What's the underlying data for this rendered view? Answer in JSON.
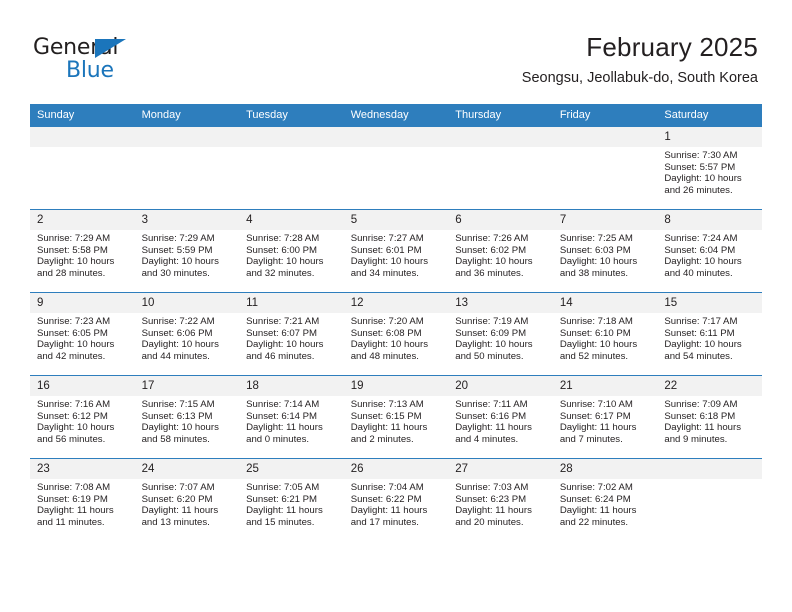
{
  "brand": {
    "name_line1": "General",
    "name_line2": "Blue",
    "icon": "triangle-logo-icon",
    "color_dark": "#221f1f",
    "color_blue": "#1b75bb"
  },
  "header": {
    "title": "February 2025",
    "subtitle": "Seongsu, Jeollabuk-do, South Korea"
  },
  "theme": {
    "header_row_bg": "#2e7ebd",
    "header_row_text": "#ffffff",
    "daynum_band_bg": "#f2f2f2",
    "cell_border": "#2e7ebd",
    "text": "#231f20"
  },
  "weekdays": [
    "Sunday",
    "Monday",
    "Tuesday",
    "Wednesday",
    "Thursday",
    "Friday",
    "Saturday"
  ],
  "labels": {
    "sunrise_prefix": "Sunrise:",
    "sunset_prefix": "Sunset:",
    "daylight_prefix": "Daylight:"
  },
  "weeks": [
    [
      {
        "day": "",
        "empty": true
      },
      {
        "day": "",
        "empty": true
      },
      {
        "day": "",
        "empty": true
      },
      {
        "day": "",
        "empty": true
      },
      {
        "day": "",
        "empty": true
      },
      {
        "day": "",
        "empty": true
      },
      {
        "day": "1",
        "sunrise": "Sunrise: 7:30 AM",
        "sunset": "Sunset: 5:57 PM",
        "daylight": "Daylight: 10 hours and 26 minutes."
      }
    ],
    [
      {
        "day": "2",
        "sunrise": "Sunrise: 7:29 AM",
        "sunset": "Sunset: 5:58 PM",
        "daylight": "Daylight: 10 hours and 28 minutes."
      },
      {
        "day": "3",
        "sunrise": "Sunrise: 7:29 AM",
        "sunset": "Sunset: 5:59 PM",
        "daylight": "Daylight: 10 hours and 30 minutes."
      },
      {
        "day": "4",
        "sunrise": "Sunrise: 7:28 AM",
        "sunset": "Sunset: 6:00 PM",
        "daylight": "Daylight: 10 hours and 32 minutes."
      },
      {
        "day": "5",
        "sunrise": "Sunrise: 7:27 AM",
        "sunset": "Sunset: 6:01 PM",
        "daylight": "Daylight: 10 hours and 34 minutes."
      },
      {
        "day": "6",
        "sunrise": "Sunrise: 7:26 AM",
        "sunset": "Sunset: 6:02 PM",
        "daylight": "Daylight: 10 hours and 36 minutes."
      },
      {
        "day": "7",
        "sunrise": "Sunrise: 7:25 AM",
        "sunset": "Sunset: 6:03 PM",
        "daylight": "Daylight: 10 hours and 38 minutes."
      },
      {
        "day": "8",
        "sunrise": "Sunrise: 7:24 AM",
        "sunset": "Sunset: 6:04 PM",
        "daylight": "Daylight: 10 hours and 40 minutes."
      }
    ],
    [
      {
        "day": "9",
        "sunrise": "Sunrise: 7:23 AM",
        "sunset": "Sunset: 6:05 PM",
        "daylight": "Daylight: 10 hours and 42 minutes."
      },
      {
        "day": "10",
        "sunrise": "Sunrise: 7:22 AM",
        "sunset": "Sunset: 6:06 PM",
        "daylight": "Daylight: 10 hours and 44 minutes."
      },
      {
        "day": "11",
        "sunrise": "Sunrise: 7:21 AM",
        "sunset": "Sunset: 6:07 PM",
        "daylight": "Daylight: 10 hours and 46 minutes."
      },
      {
        "day": "12",
        "sunrise": "Sunrise: 7:20 AM",
        "sunset": "Sunset: 6:08 PM",
        "daylight": "Daylight: 10 hours and 48 minutes."
      },
      {
        "day": "13",
        "sunrise": "Sunrise: 7:19 AM",
        "sunset": "Sunset: 6:09 PM",
        "daylight": "Daylight: 10 hours and 50 minutes."
      },
      {
        "day": "14",
        "sunrise": "Sunrise: 7:18 AM",
        "sunset": "Sunset: 6:10 PM",
        "daylight": "Daylight: 10 hours and 52 minutes."
      },
      {
        "day": "15",
        "sunrise": "Sunrise: 7:17 AM",
        "sunset": "Sunset: 6:11 PM",
        "daylight": "Daylight: 10 hours and 54 minutes."
      }
    ],
    [
      {
        "day": "16",
        "sunrise": "Sunrise: 7:16 AM",
        "sunset": "Sunset: 6:12 PM",
        "daylight": "Daylight: 10 hours and 56 minutes."
      },
      {
        "day": "17",
        "sunrise": "Sunrise: 7:15 AM",
        "sunset": "Sunset: 6:13 PM",
        "daylight": "Daylight: 10 hours and 58 minutes."
      },
      {
        "day": "18",
        "sunrise": "Sunrise: 7:14 AM",
        "sunset": "Sunset: 6:14 PM",
        "daylight": "Daylight: 11 hours and 0 minutes."
      },
      {
        "day": "19",
        "sunrise": "Sunrise: 7:13 AM",
        "sunset": "Sunset: 6:15 PM",
        "daylight": "Daylight: 11 hours and 2 minutes."
      },
      {
        "day": "20",
        "sunrise": "Sunrise: 7:11 AM",
        "sunset": "Sunset: 6:16 PM",
        "daylight": "Daylight: 11 hours and 4 minutes."
      },
      {
        "day": "21",
        "sunrise": "Sunrise: 7:10 AM",
        "sunset": "Sunset: 6:17 PM",
        "daylight": "Daylight: 11 hours and 7 minutes."
      },
      {
        "day": "22",
        "sunrise": "Sunrise: 7:09 AM",
        "sunset": "Sunset: 6:18 PM",
        "daylight": "Daylight: 11 hours and 9 minutes."
      }
    ],
    [
      {
        "day": "23",
        "sunrise": "Sunrise: 7:08 AM",
        "sunset": "Sunset: 6:19 PM",
        "daylight": "Daylight: 11 hours and 11 minutes."
      },
      {
        "day": "24",
        "sunrise": "Sunrise: 7:07 AM",
        "sunset": "Sunset: 6:20 PM",
        "daylight": "Daylight: 11 hours and 13 minutes."
      },
      {
        "day": "25",
        "sunrise": "Sunrise: 7:05 AM",
        "sunset": "Sunset: 6:21 PM",
        "daylight": "Daylight: 11 hours and 15 minutes."
      },
      {
        "day": "26",
        "sunrise": "Sunrise: 7:04 AM",
        "sunset": "Sunset: 6:22 PM",
        "daylight": "Daylight: 11 hours and 17 minutes."
      },
      {
        "day": "27",
        "sunrise": "Sunrise: 7:03 AM",
        "sunset": "Sunset: 6:23 PM",
        "daylight": "Daylight: 11 hours and 20 minutes."
      },
      {
        "day": "28",
        "sunrise": "Sunrise: 7:02 AM",
        "sunset": "Sunset: 6:24 PM",
        "daylight": "Daylight: 11 hours and 22 minutes."
      },
      {
        "day": "",
        "empty": true
      }
    ]
  ]
}
